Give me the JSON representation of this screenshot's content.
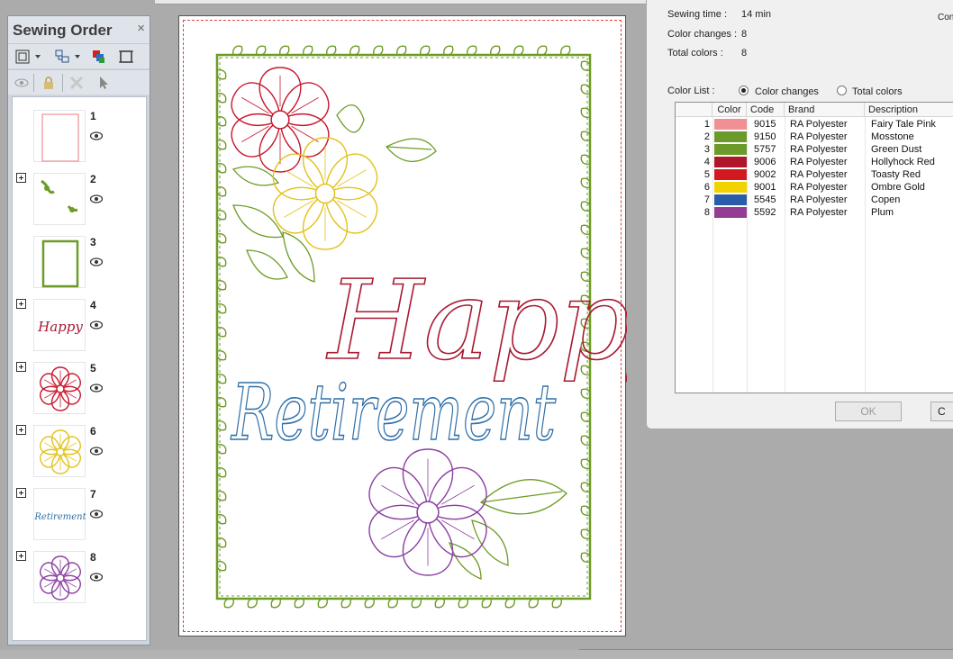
{
  "sewing_order": {
    "title": "Sewing Order",
    "close_glyph": "×",
    "items": [
      {
        "number": "1",
        "thumb": "rectangle-outline-pink",
        "expandable": false
      },
      {
        "number": "2",
        "thumb": "green-vine-leaves",
        "expandable": true
      },
      {
        "number": "3",
        "thumb": "rectangle-outline-green",
        "expandable": false
      },
      {
        "number": "4",
        "thumb": "happy-text-red",
        "expandable": true,
        "thumb_text": "Happy"
      },
      {
        "number": "5",
        "thumb": "red-flower",
        "expandable": true
      },
      {
        "number": "6",
        "thumb": "yellow-flower",
        "expandable": true
      },
      {
        "number": "7",
        "thumb": "retirement-text-blue",
        "expandable": true,
        "thumb_text": "Retirement"
      },
      {
        "number": "8",
        "thumb": "purple-flower",
        "expandable": true
      }
    ]
  },
  "design": {
    "word1": "Happy",
    "word2": "Retirement",
    "colors": {
      "border": "#e35a66",
      "vine": "#6d9b25",
      "happy": "#a81931",
      "retirement": "#2f6fa8",
      "red_flower": "#c8162c",
      "yellow_flower": "#e2c21a",
      "purple_flower": "#8c3fa1",
      "leaf": "#6d9b25"
    }
  },
  "info": {
    "sewing_time_label": "Sewing time :",
    "sewing_time_value": "14 min",
    "color_changes_label": "Color changes :",
    "color_changes_value": "8",
    "total_colors_label": "Total colors :",
    "total_colors_value": "8",
    "cut_off_label": "Con",
    "color_list_label": "Color List :",
    "radio_color_changes": "Color changes",
    "radio_total_colors": "Total colors",
    "selected_mode": "Color changes"
  },
  "table": {
    "headers": {
      "color": "Color",
      "code": "Code",
      "brand": "Brand",
      "description": "Description"
    },
    "rows": [
      {
        "num": "1",
        "swatch": "#f09095",
        "code": "9015",
        "brand": "RA Polyester",
        "description": "Fairy Tale Pink"
      },
      {
        "num": "2",
        "swatch": "#6b9a2a",
        "code": "9150",
        "brand": "RA Polyester",
        "description": "Mosstone"
      },
      {
        "num": "3",
        "swatch": "#6b9a2a",
        "code": "5757",
        "brand": "RA Polyester",
        "description": "Green Dust"
      },
      {
        "num": "4",
        "swatch": "#b01629",
        "code": "9006",
        "brand": "RA Polyester",
        "description": "Hollyhock Red"
      },
      {
        "num": "5",
        "swatch": "#d41820",
        "code": "9002",
        "brand": "RA Polyester",
        "description": "Toasty Red"
      },
      {
        "num": "6",
        "swatch": "#f2d300",
        "code": "9001",
        "brand": "RA Polyester",
        "description": "Ombre Gold"
      },
      {
        "num": "7",
        "swatch": "#2b5caa",
        "code": "5545",
        "brand": "RA Polyester",
        "description": "Copen"
      },
      {
        "num": "8",
        "swatch": "#943c94",
        "code": "5592",
        "brand": "RA Polyester",
        "description": "Plum"
      }
    ]
  },
  "buttons": {
    "ok": "OK",
    "cancel": "C"
  }
}
